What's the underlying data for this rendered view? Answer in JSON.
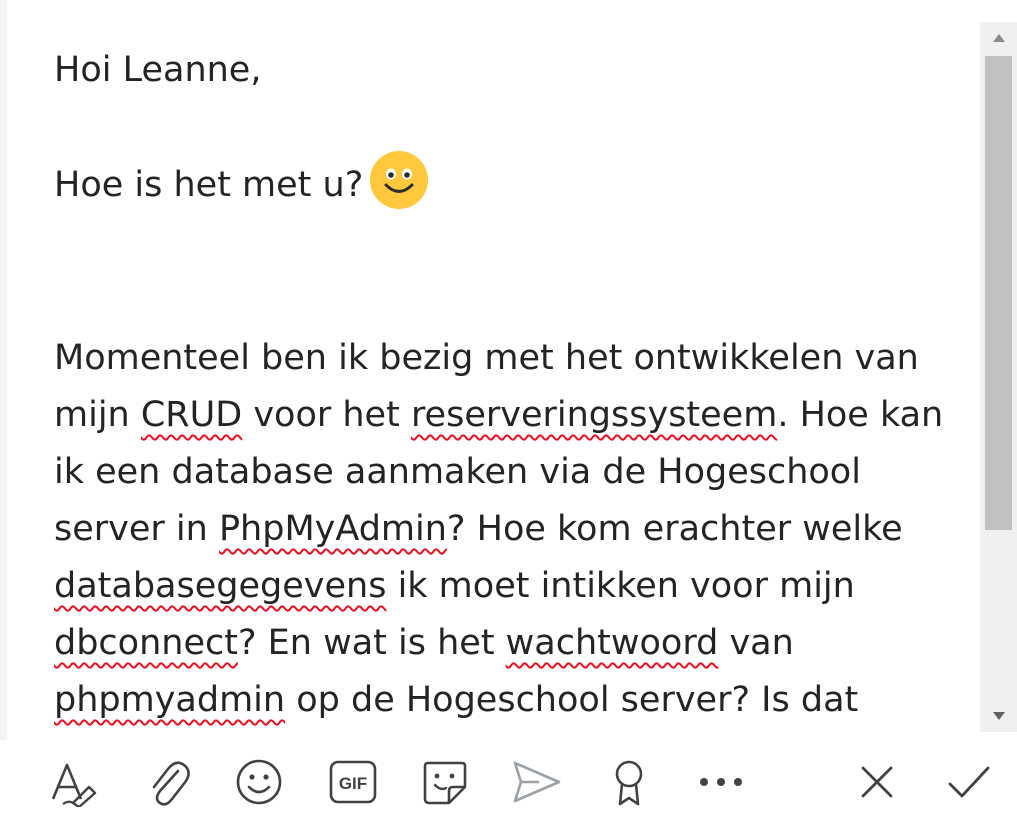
{
  "message": {
    "greeting": "Hoi Leanne,",
    "question": "Hoe is het met u?",
    "lines": [
      [
        {
          "t": "Momenteel ben ik bezig met het ontwikkelen van"
        }
      ],
      [
        {
          "t": "mijn "
        },
        {
          "t": "CRUD",
          "spell": true
        },
        {
          "t": " voor het "
        },
        {
          "t": "reserveringssysteem",
          "spell": true
        },
        {
          "t": ". Hoe kan"
        }
      ],
      [
        {
          "t": "ik een database aanmaken via de Hogeschool"
        }
      ],
      [
        {
          "t": "server in "
        },
        {
          "t": "PhpMyAdmin",
          "spell": true
        },
        {
          "t": "? Hoe kom erachter welke"
        }
      ],
      [
        {
          "t": "databasegegevens",
          "spell": true
        },
        {
          "t": " ik moet intikken voor mijn"
        }
      ],
      [
        {
          "t": "dbconnect",
          "spell": true
        },
        {
          "t": "? En wat is het "
        },
        {
          "t": "wachtwoord",
          "spell": true
        },
        {
          "t": " van"
        }
      ],
      [
        {
          "t": "phpmyadmin",
          "spell": true
        },
        {
          "t": " op de Hogeschool server? Is dat"
        }
      ]
    ]
  },
  "toolbar": {
    "items": [
      {
        "name": "format-text-icon"
      },
      {
        "name": "attach-icon"
      },
      {
        "name": "emoji-icon"
      },
      {
        "name": "gif-icon",
        "label": "GIF"
      },
      {
        "name": "sticker-icon"
      },
      {
        "name": "send-now-icon"
      },
      {
        "name": "praise-icon"
      },
      {
        "name": "more-options-icon"
      },
      {
        "name": "cancel-icon"
      },
      {
        "name": "done-icon"
      }
    ]
  },
  "colors": {
    "text": "#252423",
    "spell_underline": "#e81123",
    "icon": "#424242",
    "scrollbar_track": "#f0f0f0",
    "scrollbar_thumb": "#c1c1c1",
    "smiley": "#ffc83d"
  }
}
